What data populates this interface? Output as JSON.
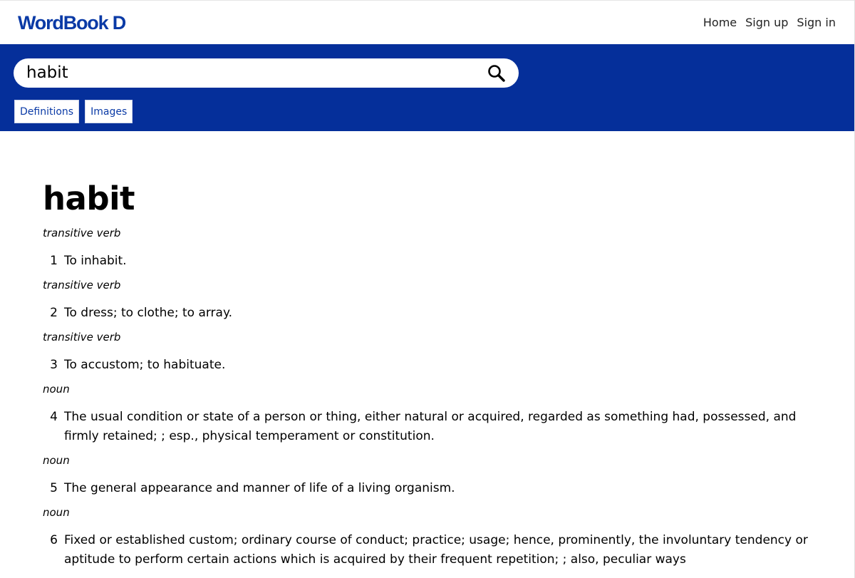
{
  "header": {
    "logo": "WordBook D",
    "nav": [
      "Home",
      "Sign up",
      "Sign in"
    ]
  },
  "search": {
    "value": "habit",
    "placeholder": ""
  },
  "tabs": [
    "Definitions",
    "Images"
  ],
  "entry": {
    "word": "habit",
    "senses": [
      {
        "pos": "transitive verb",
        "num": "1",
        "text": "To inhabit."
      },
      {
        "pos": "transitive verb",
        "num": "2",
        "text": "To dress; to clothe; to array."
      },
      {
        "pos": "transitive verb",
        "num": "3",
        "text": "To accustom; to habituate."
      },
      {
        "pos": "noun",
        "num": "4",
        "text": "The usual condition or state of a person or thing, either natural or acquired, regarded as something had, possessed, and firmly retained; ; esp., physical temperament or constitution."
      },
      {
        "pos": "noun",
        "num": "5",
        "text": "The general appearance and manner of life of a living organism."
      },
      {
        "pos": "noun",
        "num": "6",
        "text": "Fixed or established custom; ordinary course of conduct; practice; usage; hence, prominently, the involuntary tendency or aptitude to perform certain actions which is acquired by their frequent repetition; ; also, peculiar ways"
      }
    ]
  },
  "colors": {
    "brand": "#0a3aa6",
    "band": "#052f9a"
  }
}
